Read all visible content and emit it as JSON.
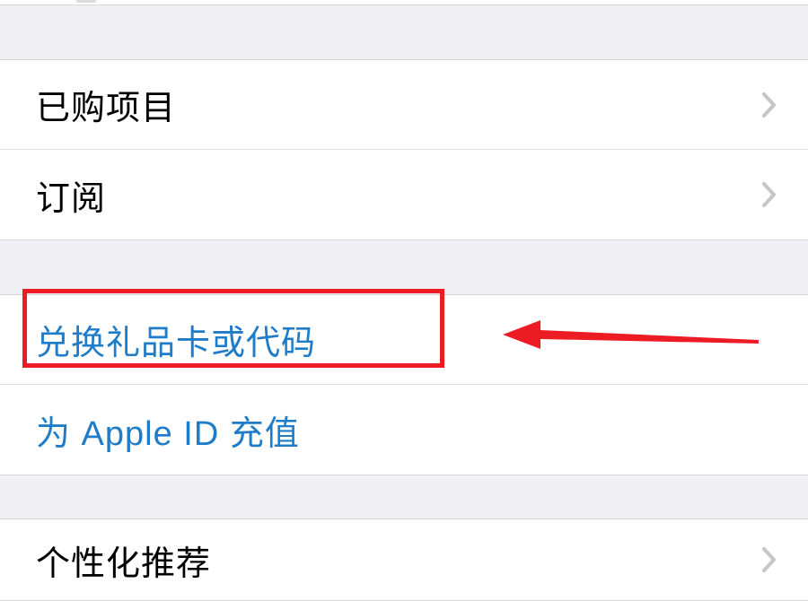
{
  "group1": {
    "items": [
      {
        "label": "已购项目"
      },
      {
        "label": "订阅"
      }
    ]
  },
  "group2": {
    "items": [
      {
        "label": "兑换礼品卡或代码"
      },
      {
        "label": "为 Apple ID 充值"
      }
    ]
  },
  "group3": {
    "items": [
      {
        "label": "个性化推荐"
      }
    ]
  },
  "annotation": {
    "highlight_color": "#ed1c24",
    "arrow_color": "#ed1c24"
  }
}
